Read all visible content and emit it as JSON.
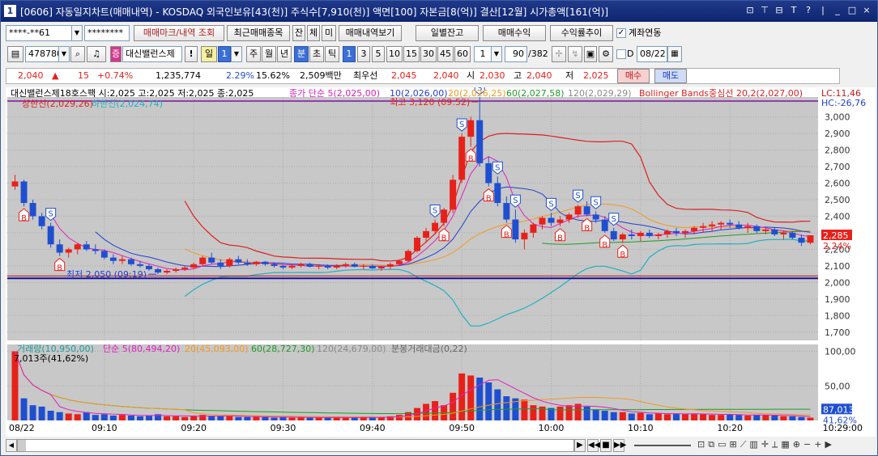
{
  "window": {
    "number": "1",
    "title": "[0606] 자동일지차트(매매내역) - KOSDAQ 외국인보유[43(천)] 주식수[7,910(천)] 액면[100] 자본금[8(억)] 결산[12월] 시가총액[161(억)]",
    "controls": [
      "⊡",
      "⊤",
      "⊟",
      "T",
      "?",
      "|",
      "_",
      "□",
      "×"
    ]
  },
  "toolbar1": {
    "account": "****-**61",
    "password": "********",
    "btn_mark": "매매마크/내역 조회",
    "btn_recent": "최근매매종목",
    "btn_jan": "잔",
    "btn_che": "체",
    "btn_mi": "미",
    "btn_view": "매매내역보기",
    "btn_daily": "일별잔고",
    "btn_profit": "매매수익",
    "btn_rate": "수익률추이",
    "link_label": "계좌연동"
  },
  "toolbar2": {
    "code": "478780",
    "name": "대신밸런스제",
    "period_btns": [
      "일",
      "1",
      "주",
      "월",
      "년",
      "분",
      "초",
      "틱"
    ],
    "minute_btns": [
      "1",
      "3",
      "5",
      "10",
      "15",
      "30",
      "45",
      "60"
    ],
    "count": "1",
    "display": "90",
    "total": "/382",
    "d_label": "D",
    "date": "08/22"
  },
  "quote": {
    "price": "2,040",
    "change": "15",
    "change_pct": "+0.74%",
    "volume": "1,235,774",
    "vol_ratio": "2.29%",
    "turnover": "15.62%",
    "amount": "2,509백만",
    "ask_label": "최우선",
    "ask": "2,045",
    "bid": "2,040",
    "open_label": "시",
    "open": "2,030",
    "high_label": "고",
    "high": "2,040",
    "low_label": "저",
    "low": "2,025",
    "buy": "매수",
    "sell": "매도"
  },
  "legend": {
    "price_title": "대신밸런스제18호스팩 시:2,025 고:2,025 저:2,025 종:2,025",
    "ma5": "종가 단순 5(2,025,00)",
    "ma10": "10(2,026,00)",
    "ma20": "20(2,026,25)",
    "ma60": "60(2,027,58)",
    "ma120": "120(2,029,29)",
    "bb": "Bollinger Bands중심선 20,2(2,027,00)",
    "bb_upper": "상한선(2,029,26)",
    "bb_lower": "하한선(2,024,74)",
    "lc": "LC:11,46",
    "hc": "HC:-26,76",
    "max_label": "최고 3,120 (09:52)",
    "min_label": "최저 2,050 (09:19)",
    "cur_price": "2,285",
    "cur_pct": "2,24%",
    "vol_title": "거래량(10,950,00)",
    "vma5": "단순 5(80,494,20)",
    "vma20": "20(45,093,00)",
    "vma60": "60(28,727,30)",
    "vma120": "120(24,679,00)",
    "amt": "분봉거래대금(0,22)",
    "vol_max": "7,013주(41,62%)",
    "vol_cur": "87,013",
    "vol_cur_pct": "41,62%"
  },
  "colors": {
    "up": "#e8201a",
    "down": "#1f4fd0",
    "ma5": "#e020c0",
    "ma10": "#1f3fd0",
    "ma20": "#f29a1e",
    "ma60": "#1f9a28",
    "ma120": "#8a8a8a",
    "bb_upper": "#dd1f1f",
    "bb_lower": "#20b0c0",
    "bg": "#c8c8c8"
  },
  "chart_data": {
    "type": "candlestick",
    "price_axis": [
      "3,000",
      "2,900",
      "2,800",
      "2,700",
      "2,600",
      "2,500",
      "2,400",
      "2,300",
      "2,200",
      "2,100",
      "2,000",
      "1,900",
      "1,800",
      "1,700"
    ],
    "price_ticks": [
      3000,
      2900,
      2800,
      2700,
      2600,
      2500,
      2400,
      2300,
      2200,
      2100,
      2000,
      1900,
      1800,
      1700
    ],
    "vol_axis": [
      "100,00",
      "50,00"
    ],
    "vol_ticks": [
      100,
      50
    ],
    "time_axis": [
      "08/22",
      "09:10",
      "09:20",
      "09:30",
      "09:40",
      "09:50",
      "10:00",
      "10:10",
      "10:20",
      "10:29:00"
    ],
    "time_index": [
      0,
      10,
      20,
      30,
      40,
      50,
      60,
      70,
      80,
      89
    ],
    "ohlc": [
      [
        2580,
        2650,
        2560,
        2610
      ],
      [
        2610,
        2620,
        2460,
        2480
      ],
      [
        2480,
        2500,
        2380,
        2400
      ],
      [
        2400,
        2420,
        2320,
        2340
      ],
      [
        2340,
        2360,
        2210,
        2230
      ],
      [
        2230,
        2260,
        2160,
        2180
      ],
      [
        2180,
        2210,
        2150,
        2200
      ],
      [
        2200,
        2240,
        2170,
        2230
      ],
      [
        2230,
        2250,
        2190,
        2200
      ],
      [
        2200,
        2230,
        2170,
        2190
      ],
      [
        2190,
        2200,
        2140,
        2150
      ],
      [
        2150,
        2170,
        2110,
        2130
      ],
      [
        2130,
        2160,
        2110,
        2140
      ],
      [
        2140,
        2150,
        2100,
        2110
      ],
      [
        2110,
        2130,
        2090,
        2100
      ],
      [
        2100,
        2110,
        2070,
        2080
      ],
      [
        2080,
        2090,
        2050,
        2060
      ],
      [
        2060,
        2080,
        2050,
        2070
      ],
      [
        2070,
        2090,
        2060,
        2080
      ],
      [
        2080,
        2100,
        2070,
        2090
      ],
      [
        2090,
        2120,
        2080,
        2110
      ],
      [
        2110,
        2160,
        2100,
        2150
      ],
      [
        2150,
        2180,
        2110,
        2120
      ],
      [
        2120,
        2140,
        2080,
        2100
      ],
      [
        2100,
        2150,
        2090,
        2140
      ],
      [
        2140,
        2160,
        2110,
        2120
      ],
      [
        2120,
        2140,
        2100,
        2110
      ],
      [
        2110,
        2130,
        2100,
        2125
      ],
      [
        2125,
        2130,
        2100,
        2110
      ],
      [
        2110,
        2120,
        2090,
        2100
      ],
      [
        2100,
        2110,
        2080,
        2090
      ],
      [
        2090,
        2110,
        2080,
        2100
      ],
      [
        2100,
        2120,
        2090,
        2110
      ],
      [
        2110,
        2120,
        2090,
        2095
      ],
      [
        2095,
        2110,
        2080,
        2100
      ],
      [
        2100,
        2110,
        2080,
        2090
      ],
      [
        2090,
        2110,
        2080,
        2100
      ],
      [
        2100,
        2120,
        2090,
        2110
      ],
      [
        2110,
        2120,
        2090,
        2095
      ],
      [
        2095,
        2110,
        2080,
        2100
      ],
      [
        2100,
        2110,
        2080,
        2085
      ],
      [
        2085,
        2100,
        2070,
        2095
      ],
      [
        2095,
        2120,
        2080,
        2110
      ],
      [
        2110,
        2140,
        2100,
        2130
      ],
      [
        2130,
        2200,
        2120,
        2190
      ],
      [
        2190,
        2280,
        2180,
        2270
      ],
      [
        2270,
        2330,
        2240,
        2310
      ],
      [
        2310,
        2380,
        2290,
        2360
      ],
      [
        2360,
        2450,
        2340,
        2440
      ],
      [
        2440,
        2650,
        2420,
        2620
      ],
      [
        2620,
        2900,
        2600,
        2880
      ],
      [
        2880,
        3000,
        2820,
        2980
      ],
      [
        2980,
        3120,
        2700,
        2720
      ],
      [
        2720,
        2760,
        2580,
        2600
      ],
      [
        2600,
        2640,
        2460,
        2480
      ],
      [
        2480,
        2520,
        2360,
        2380
      ],
      [
        2380,
        2440,
        2240,
        2260
      ],
      [
        2260,
        2320,
        2200,
        2300
      ],
      [
        2300,
        2360,
        2270,
        2350
      ],
      [
        2350,
        2400,
        2320,
        2390
      ],
      [
        2390,
        2420,
        2340,
        2360
      ],
      [
        2360,
        2400,
        2340,
        2380
      ],
      [
        2380,
        2420,
        2360,
        2410
      ],
      [
        2410,
        2470,
        2390,
        2460
      ],
      [
        2460,
        2490,
        2400,
        2410
      ],
      [
        2410,
        2430,
        2360,
        2380
      ],
      [
        2380,
        2400,
        2300,
        2310
      ],
      [
        2310,
        2330,
        2250,
        2260
      ],
      [
        2260,
        2300,
        2240,
        2290
      ],
      [
        2290,
        2320,
        2260,
        2280
      ],
      [
        2280,
        2310,
        2250,
        2300
      ],
      [
        2300,
        2320,
        2270,
        2280
      ],
      [
        2280,
        2300,
        2260,
        2290
      ],
      [
        2290,
        2320,
        2270,
        2310
      ],
      [
        2310,
        2330,
        2280,
        2300
      ],
      [
        2300,
        2320,
        2270,
        2310
      ],
      [
        2310,
        2340,
        2290,
        2330
      ],
      [
        2330,
        2360,
        2300,
        2340
      ],
      [
        2340,
        2370,
        2310,
        2350
      ],
      [
        2350,
        2370,
        2320,
        2360
      ],
      [
        2360,
        2380,
        2330,
        2350
      ],
      [
        2350,
        2370,
        2320,
        2330
      ],
      [
        2330,
        2360,
        2300,
        2340
      ],
      [
        2340,
        2350,
        2300,
        2310
      ],
      [
        2310,
        2330,
        2290,
        2320
      ],
      [
        2320,
        2330,
        2280,
        2290
      ],
      [
        2290,
        2310,
        2260,
        2300
      ],
      [
        2300,
        2310,
        2260,
        2270
      ],
      [
        2270,
        2290,
        2220,
        2240
      ],
      [
        2240,
        2280,
        2230,
        2285
      ]
    ],
    "volume": [
      100,
      32,
      22,
      20,
      14,
      12,
      10,
      9,
      12,
      8,
      9,
      7,
      8,
      7,
      6,
      7,
      9,
      6,
      6,
      5,
      6,
      8,
      7,
      6,
      6,
      5,
      5,
      6,
      5,
      4,
      5,
      4,
      5,
      4,
      4,
      4,
      5,
      4,
      4,
      5,
      4,
      5,
      6,
      8,
      12,
      18,
      24,
      28,
      22,
      40,
      68,
      65,
      62,
      55,
      45,
      35,
      32,
      30,
      22,
      20,
      18,
      20,
      22,
      24,
      20,
      16,
      14,
      12,
      12,
      10,
      11,
      9,
      10,
      9,
      10,
      9,
      10,
      9,
      8,
      8,
      9,
      8,
      7,
      8,
      8,
      7,
      6,
      6,
      5,
      4
    ],
    "trade_marks": [
      {
        "i": 1,
        "type": "B"
      },
      {
        "i": 4,
        "type": "S"
      },
      {
        "i": 5,
        "type": "B"
      },
      {
        "i": 47,
        "type": "S"
      },
      {
        "i": 48,
        "type": "B"
      },
      {
        "i": 50,
        "type": "S"
      },
      {
        "i": 51,
        "type": "B"
      },
      {
        "i": 52,
        "type": "S"
      },
      {
        "i": 53,
        "type": "B"
      },
      {
        "i": 54,
        "type": "S"
      },
      {
        "i": 55,
        "type": "B"
      },
      {
        "i": 56,
        "type": "S"
      },
      {
        "i": 60,
        "type": "S"
      },
      {
        "i": 61,
        "type": "B"
      },
      {
        "i": 63,
        "type": "S"
      },
      {
        "i": 64,
        "type": "B"
      },
      {
        "i": 65,
        "type": "S"
      },
      {
        "i": 66,
        "type": "B"
      },
      {
        "i": 67,
        "type": "S"
      },
      {
        "i": 68,
        "type": "B"
      }
    ],
    "support_line": 2025,
    "ylim": [
      1650,
      3120
    ],
    "vol_ylim": [
      0,
      110
    ]
  }
}
